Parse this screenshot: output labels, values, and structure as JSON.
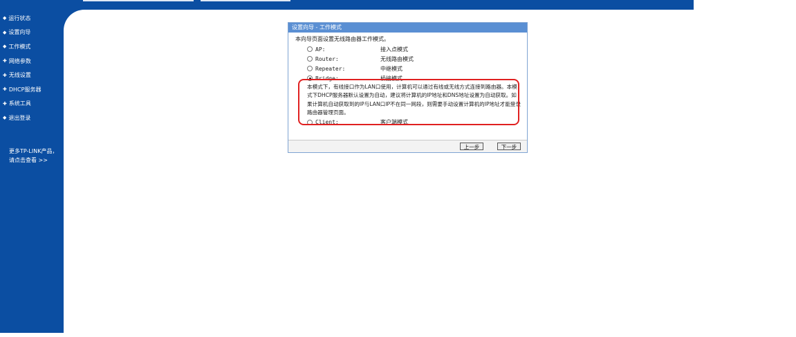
{
  "sidebar": {
    "items": [
      {
        "label": "运行状态"
      },
      {
        "label": "设置向导"
      },
      {
        "label": "工作模式"
      },
      {
        "label": "网络参数"
      },
      {
        "label": "无线设置"
      },
      {
        "label": "DHCP服务器"
      },
      {
        "label": "系统工具"
      },
      {
        "label": "退出登录"
      }
    ],
    "more_line1": "更多TP-LINK产品，",
    "more_line2": "请点击查看 >>"
  },
  "wizard": {
    "title": "设置向导 - 工作模式",
    "intro": "本向导页面设置无线路由器工作模式。",
    "options": [
      {
        "name": "AP:",
        "desc": "接入点模式",
        "selected": false
      },
      {
        "name": "Router:",
        "desc": "无线路由模式",
        "selected": false
      },
      {
        "name": "Repeater:",
        "desc": "中继模式",
        "selected": false
      },
      {
        "name": "Bridge:",
        "desc": "桥接模式",
        "selected": true
      },
      {
        "name": "Client:",
        "desc": "客户端模式",
        "selected": false
      }
    ],
    "bridge_description": "本模式下，有线接口作为LAN口使用，计算机可以通过有线或无线方式连接到路由器。本模式下DHCP服务器默认设置为自动，建议将计算机的IP地址和DNS地址设置为自动获取。如果计算机自动获取到的IP与LAN口IP不在同一网段，则需要手动设置计算机的IP地址才能登录路由器管理页面。",
    "prev_button": "上一步",
    "next_button": "下一步"
  },
  "colors": {
    "brand_blue": "#0b4ea2",
    "title_bar": "#5a8fd3",
    "highlight": "#e02020"
  }
}
